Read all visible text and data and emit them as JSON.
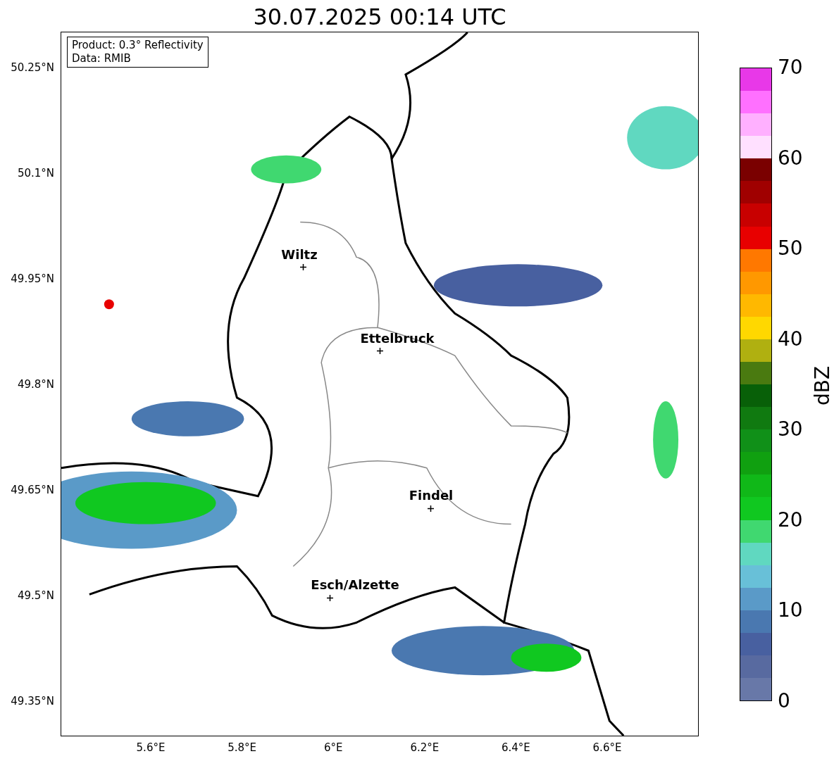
{
  "title": "30.07.2025 00:14 UTC",
  "info_box": [
    "Product: 0.3° Reflectivity",
    "Data: RMIB"
  ],
  "places": [
    {
      "name": "Wiltz"
    },
    {
      "name": "Ettelbruck"
    },
    {
      "name": "Findel"
    },
    {
      "name": "Esch/Alzette"
    }
  ],
  "y_ticks": [
    "50.25°N",
    "50.1°N",
    "49.95°N",
    "49.8°N",
    "49.65°N",
    "49.5°N",
    "49.35°N"
  ],
  "x_ticks": [
    "5.6°E",
    "5.8°E",
    "6°E",
    "6.2°E",
    "6.4°E",
    "6.6°E"
  ],
  "colorbar": {
    "label": "dBZ",
    "ticks": [
      "70",
      "60",
      "50",
      "40",
      "30",
      "20",
      "10",
      "0"
    ],
    "bands": [
      {
        "color": "#e838e8"
      },
      {
        "color": "#ff70ff"
      },
      {
        "color": "#ffb0ff"
      },
      {
        "color": "#ffe0ff"
      },
      {
        "color": "#7a0000"
      },
      {
        "color": "#a00000"
      },
      {
        "color": "#c80000"
      },
      {
        "color": "#e80000"
      },
      {
        "color": "#ff7800"
      },
      {
        "color": "#ff9800"
      },
      {
        "color": "#ffb800"
      },
      {
        "color": "#ffd800"
      },
      {
        "color": "#b0b010"
      },
      {
        "color": "#4a7a10"
      },
      {
        "color": "#086008"
      },
      {
        "color": "#107a10"
      },
      {
        "color": "#109018"
      },
      {
        "color": "#10a010"
      },
      {
        "color": "#10b818"
      },
      {
        "color": "#10c820"
      },
      {
        "color": "#40d870"
      },
      {
        "color": "#60d8c0"
      },
      {
        "color": "#68c0d8"
      },
      {
        "color": "#5a9ac8"
      },
      {
        "color": "#4a78b0"
      },
      {
        "color": "#4860a0"
      },
      {
        "color": "#586aa0"
      },
      {
        "color": "#6878a8"
      }
    ]
  }
}
